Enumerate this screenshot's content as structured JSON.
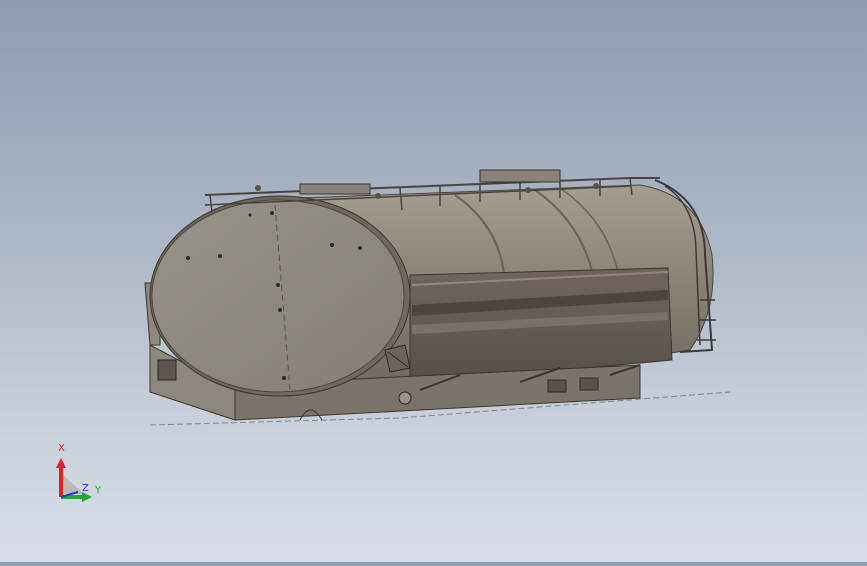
{
  "viewport": {
    "background_top": "#8f9db0",
    "background_bottom": "#d8dde5",
    "model_color": "#8a8378",
    "model_dark": "#5e564f"
  },
  "triad": {
    "x_label": "X",
    "y_label": "Y",
    "z_label": "Z",
    "x_color": "#e0202a",
    "y_color": "#1faa2e",
    "z_color": "#2a36d8"
  }
}
